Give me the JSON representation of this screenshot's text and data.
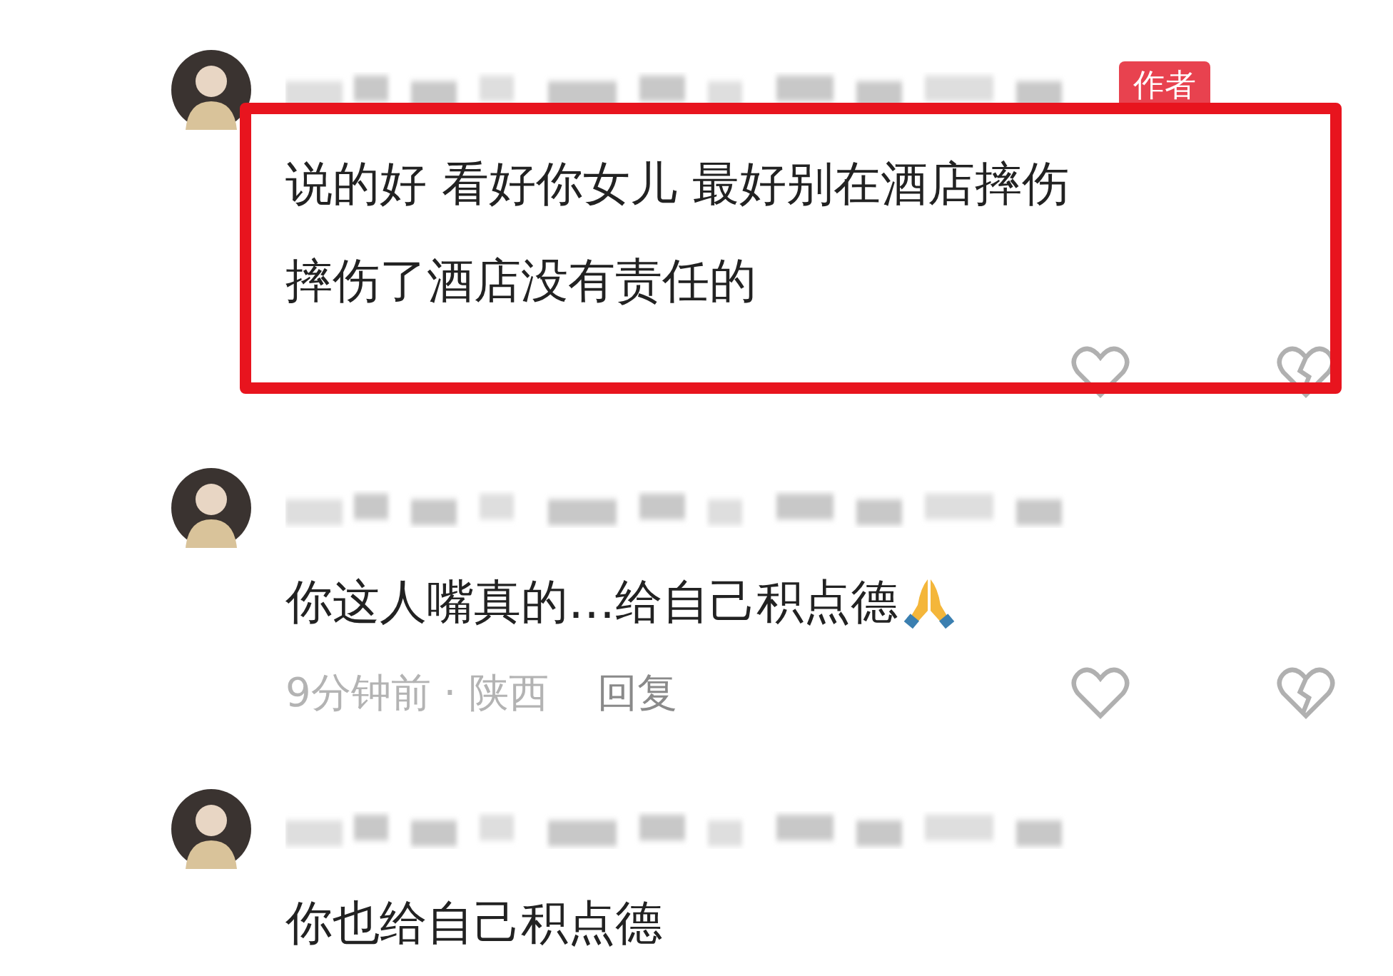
{
  "comments": [
    {
      "author_badge": "作者",
      "highlighted": true,
      "text_lines": [
        "说的好 看好你女儿 最好别在酒店摔伤",
        "摔伤了酒店没有责任的"
      ],
      "trailing_emoji": false,
      "actions": true
    },
    {
      "highlighted": false,
      "text_lines": [
        "你这人嘴真的…给自己积点德"
      ],
      "trailing_emoji": true,
      "actions": true,
      "meta": [
        "9分钟前 · 陕西"
      ],
      "reply": "回复"
    },
    {
      "highlighted": false,
      "text_lines": [
        "你也给自己积点德"
      ],
      "trailing_emoji": false,
      "actions": false
    }
  ]
}
